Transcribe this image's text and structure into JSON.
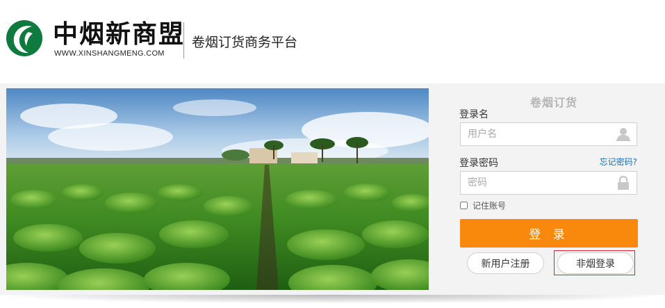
{
  "brand": {
    "name": "中烟新商盟",
    "url_text": "WWW.XINSHANGMENG.COM",
    "tagline": "卷烟订货商务平台",
    "logo_color": "#0e7a3e"
  },
  "login": {
    "title": "卷烟订货",
    "username_label": "登录名",
    "username_placeholder": "用户名",
    "username_icon": "user-icon",
    "password_label": "登录密码",
    "password_placeholder": "密码",
    "password_icon": "lock-icon",
    "forgot_link": "忘记密码?",
    "remember_label": "记住账号",
    "remember_checked": false,
    "submit_label": "登 录",
    "register_label": "新用户注册",
    "nonsmoke_label": "非烟登录"
  },
  "colors": {
    "accent": "#f8890c",
    "link": "#1a6fb5",
    "highlight_frame": "#d62a2a"
  },
  "hero": {
    "image": "tobacco-field-photo"
  }
}
